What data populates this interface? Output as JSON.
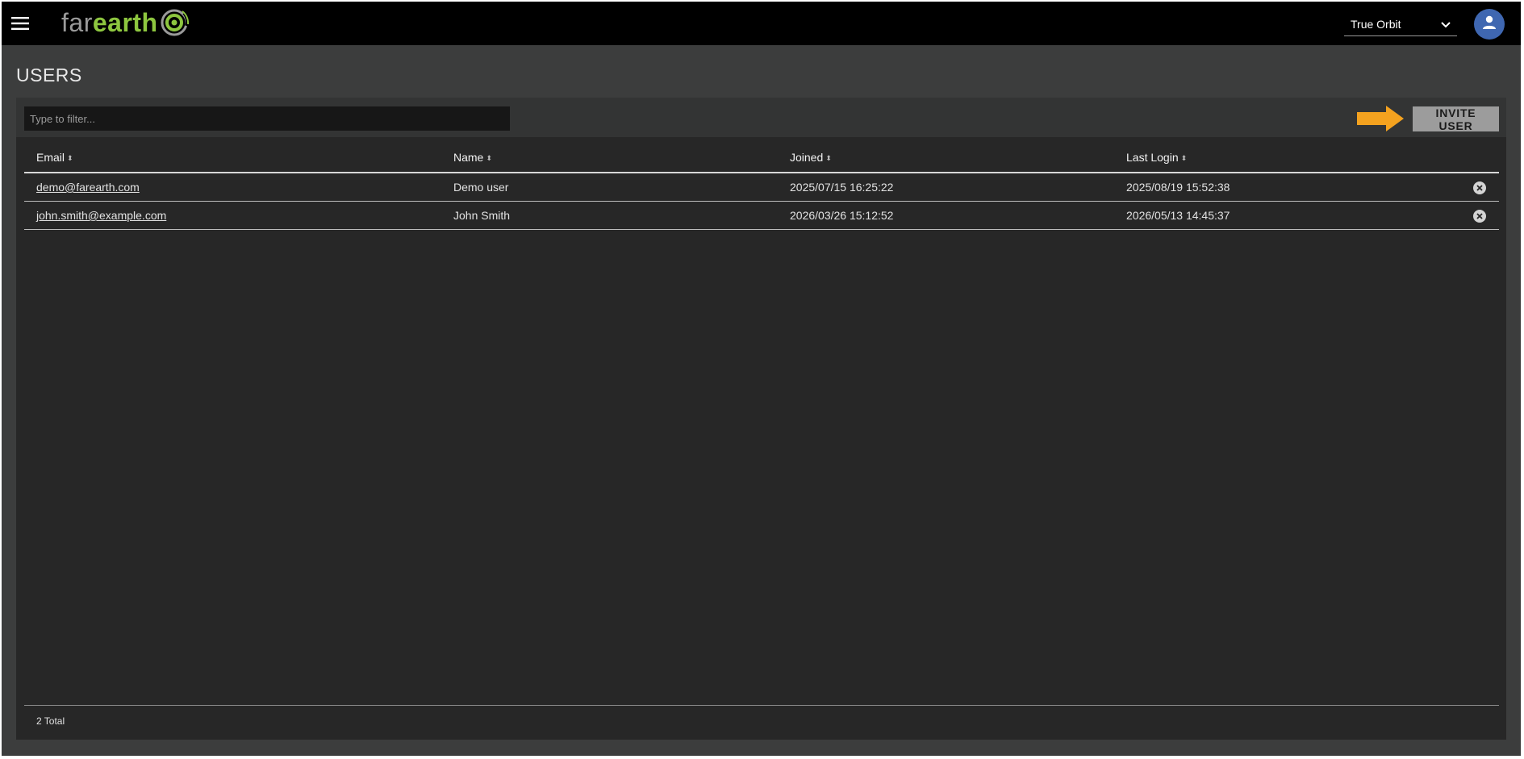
{
  "header": {
    "logo_far": "far",
    "logo_earth": "earth",
    "org_select": {
      "selected": "True Orbit"
    },
    "colors": {
      "brand_green": "#8dc63f",
      "avatar_blue": "#3f67b1",
      "arrow_orange": "#f4a21f"
    }
  },
  "page": {
    "title": "USERS"
  },
  "toolbar": {
    "filter_placeholder": "Type to filter...",
    "invite_label": "INVITE USER"
  },
  "table": {
    "columns": [
      "Email",
      "Name",
      "Joined",
      "Last Login"
    ],
    "rows": [
      {
        "email": "demo@farearth.com",
        "name": "Demo user",
        "joined": "2025/07/15 16:25:22",
        "last_login": "2025/08/19 15:52:38"
      },
      {
        "email": "john.smith@example.com",
        "name": "John Smith",
        "joined": "2026/03/26 15:12:52",
        "last_login": "2026/05/13 14:45:37"
      }
    ]
  },
  "footer": {
    "total": "2 Total"
  }
}
